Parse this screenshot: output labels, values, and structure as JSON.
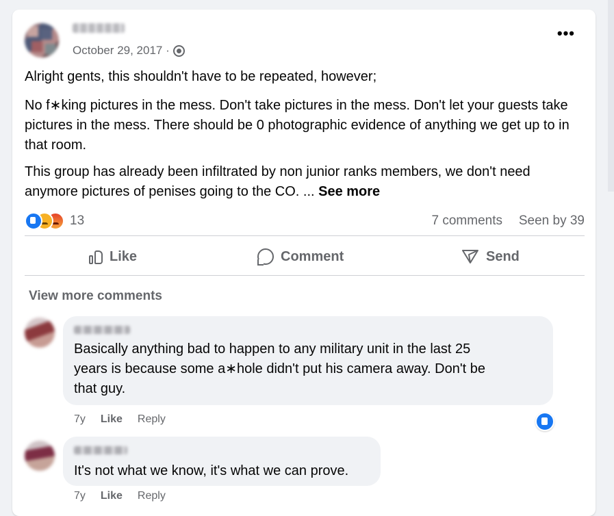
{
  "post": {
    "date": "October 29, 2017 ·",
    "more_label": "•••",
    "paragraphs": [
      "Alright gents, this shouldn't have to be repeated, however;",
      "No f∗king pictures in the mess. Don't take pictures in the mess. Don't let your guests take pictures in the mess. There should be 0 photographic evidence of anything we get up to in that room.",
      "This group has already been infiltrated by non junior ranks members, we don't need anymore pictures of penises going to the CO. ..."
    ],
    "see_more": "See more",
    "reactions": {
      "icons": [
        "like-icon",
        "sad-icon",
        "angry-icon"
      ],
      "count": "13"
    },
    "comments_count": "7 comments",
    "seen_by": "Seen by 39",
    "actions": {
      "like": "Like",
      "comment": "Comment",
      "send": "Send"
    }
  },
  "comments_section": {
    "view_more": "View more comments",
    "comments": [
      {
        "text_lines": [
          "Basically anything bad to happen to any military unit in the last 25",
          "years is because some a∗hole didn't put his camera away. Don't be",
          "that guy."
        ],
        "time": "7y",
        "like": "Like",
        "reply": "Reply",
        "reaction": "like-icon"
      },
      {
        "text_lines": [
          "It's not what we know, it's what we can prove."
        ],
        "time": "7y",
        "like": "Like",
        "reply": "Reply"
      }
    ]
  },
  "colors": {
    "background": "#f0f2f5",
    "card": "#ffffff",
    "text": "#050505",
    "secondary_text": "#65676b",
    "like_blue": "#1877f2"
  }
}
